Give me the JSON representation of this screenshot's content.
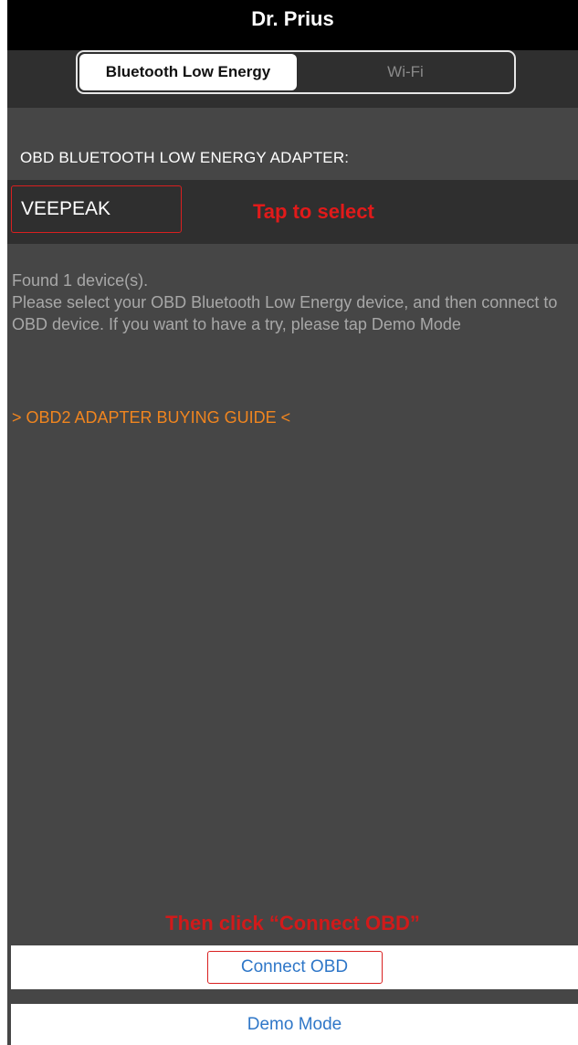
{
  "header": {
    "title": "Dr. Prius"
  },
  "segments": [
    {
      "label": "Bluetooth Low Energy",
      "selected": true
    },
    {
      "label": "Wi-Fi",
      "selected": false
    }
  ],
  "adapter_section": {
    "header": "OBD BLUETOOTH LOW ENERGY ADAPTER:",
    "selected_device": "VEEPEAK",
    "tap_hint": "Tap to select"
  },
  "info": {
    "found": "Found 1 device(s).",
    "instructions": "Please select your OBD Bluetooth Low Energy device, and then connect to OBD device. If you want to have a try, please tap Demo Mode"
  },
  "guide_link": "> OBD2 ADAPTER BUYING GUIDE <",
  "connect_hint": "Then click “Connect OBD”",
  "actions": {
    "connect": "Connect OBD",
    "demo": "Demo Mode"
  },
  "colors": {
    "background": "#464646",
    "title_bar": "#000000",
    "link_orange": "#f0851f",
    "annotation_red": "#e11a1a",
    "button_blue": "#2f77c8"
  }
}
